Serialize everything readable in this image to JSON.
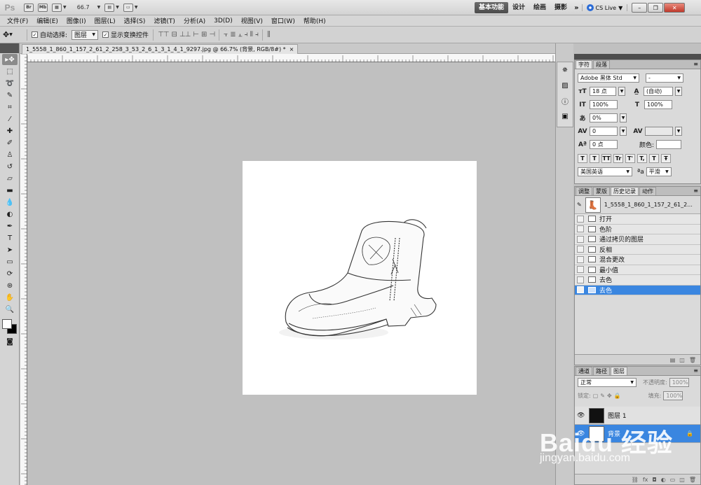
{
  "app": {
    "logo": "Ps",
    "zoom": "66.7",
    "workspaces": [
      "基本功能",
      "设计",
      "绘画",
      "摄影"
    ],
    "active_workspace": "基本功能",
    "more": "»",
    "cslive": "CS Live"
  },
  "menu": [
    "文件(F)",
    "编辑(E)",
    "图像(I)",
    "图层(L)",
    "选择(S)",
    "滤镜(T)",
    "分析(A)",
    "3D(D)",
    "视图(V)",
    "窗口(W)",
    "帮助(H)"
  ],
  "options": {
    "auto_select_label": "自动选择:",
    "auto_select_value": "图层",
    "show_transform_label": "显示变换控件"
  },
  "document": {
    "tab_title": "1_5558_1_860_1_157_2_61_2_258_3_53_2_6_1_3_1_4_1_9297.jpg @ 66.7% (背景, RGB/8#) *",
    "tab_close": "×"
  },
  "character_panel": {
    "tabs": [
      "字符",
      "段落"
    ],
    "font_family": "Adobe 黑体 Std",
    "font_style": "-",
    "font_size": "18 点",
    "leading": "(自动)",
    "vertical_scale": "100%",
    "horizontal_scale": "100%",
    "tsume": "0%",
    "kerning": "0",
    "tracking": "",
    "baseline_shift": "0 点",
    "color_label": "颜色:",
    "format_buttons": [
      "T",
      "T",
      "TT",
      "Tr",
      "T'",
      "T,",
      "T",
      "Ŧ"
    ],
    "language": "美国英语",
    "aa_label": "ªa",
    "antialias": "平滑"
  },
  "history_panel": {
    "tabs": [
      "调整",
      "蒙版",
      "历史记录",
      "动作"
    ],
    "snapshot_name": "1_5558_1_860_1_157_2_61_2...",
    "items": [
      "打开",
      "色阶",
      "通过拷贝的图层",
      "反相",
      "混合更改",
      "最小值",
      "去色",
      "去色"
    ],
    "selected_index": 7
  },
  "layers_panel": {
    "tabs": [
      "通道",
      "路径",
      "图层"
    ],
    "blend_mode": "正常",
    "opacity_label": "不透明度:",
    "opacity": "100%",
    "lock_label": "锁定:",
    "fill_label": "填充:",
    "fill": "100%",
    "layers": [
      {
        "name": "图层 1",
        "selected": false
      },
      {
        "name": "背景",
        "selected": true
      }
    ]
  },
  "watermark": {
    "brand": "Baidu 经验",
    "url": "jingyan.baidu.com"
  }
}
